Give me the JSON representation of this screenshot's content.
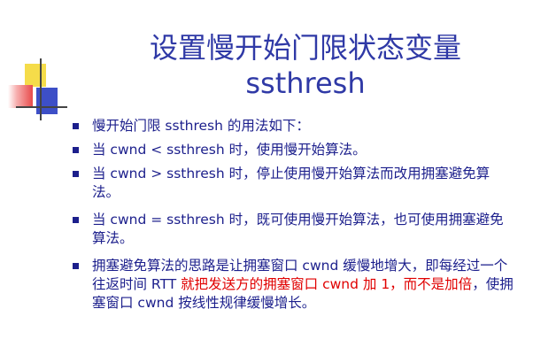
{
  "title": {
    "line1": "设置慢开始门限状态变量",
    "line2": "ssthresh"
  },
  "bullets": [
    {
      "text": "慢开始门限 ssthresh 的用法如下："
    },
    {
      "text": "当 cwnd < ssthresh 时，使用慢开始算法。"
    },
    {
      "text": "当 cwnd > ssthresh 时，停止使用慢开始算法而改用拥塞避免算法。"
    },
    {
      "text": "当 cwnd = ssthresh 时，既可使用慢开始算法，也可使用拥塞避免算法。"
    },
    {
      "part1": "拥塞避免算法的思路是让拥塞窗口 cwnd 缓慢地增大，即每经过一个往返时间 RTT ",
      "part2_red": "就把发送方的拥塞窗口 cwnd 加 1，而不是加倍",
      "part3": "，使拥塞窗口 cwnd 按线性规律缓慢增长。"
    }
  ],
  "colors": {
    "title": "#2f39a6",
    "body": "#1c1f8c",
    "highlight": "#e00000",
    "deco_yellow": "#f5dc4a",
    "deco_red": "#e84a4a",
    "deco_blue": "#3d4fc7"
  }
}
